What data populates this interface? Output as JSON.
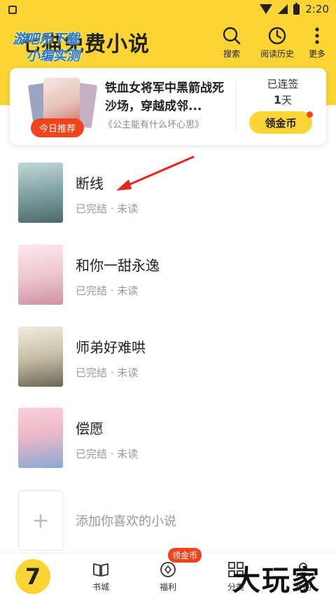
{
  "status_bar": {
    "time": "2:20"
  },
  "header": {
    "app_title": "七猫免费小说",
    "watermark_line1": "游吧乐下载",
    "watermark_line2": "小编实测",
    "actions": {
      "search": "搜索",
      "history": "阅读历史",
      "more": "更多"
    }
  },
  "recommend": {
    "badge": "今日推荐",
    "title": "铁血女将军中黑箭战死沙场，穿越成邻...",
    "subtitle": "《公主能有什么坏心思》",
    "checkin_label": "已连签",
    "checkin_days": "1",
    "checkin_unit": "天",
    "coin_button": "领金币"
  },
  "shelf": {
    "books": [
      {
        "title": "断线",
        "status": "已完结 · 未读",
        "cover_color": "#7fa3a8"
      },
      {
        "title": "和你一甜永逸",
        "status": "已完结 · 未读",
        "cover_color": "#f3c9d3"
      },
      {
        "title": "师弟好难哄",
        "status": "已完结 · 未读",
        "cover_color": "#c9bfa3"
      },
      {
        "title": "偿愿",
        "status": "已完结 · 未读",
        "cover_color": "#f0b6c8"
      }
    ],
    "add_label": "添加你喜欢的小说",
    "add_symbol": "+"
  },
  "tabbar": {
    "home_symbol": "7",
    "tabs": {
      "bookstore": "书城",
      "welfare": "福利",
      "category": "分类",
      "mine": "我的"
    },
    "welfare_badge": "领金币"
  },
  "corner_watermark": "大玩家"
}
